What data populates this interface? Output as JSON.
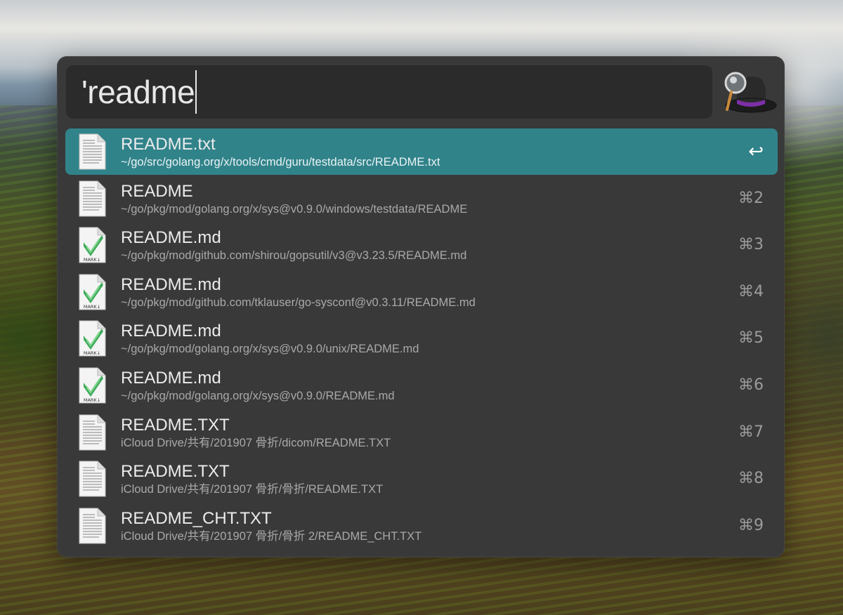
{
  "search": {
    "query": "'readme"
  },
  "results": [
    {
      "title": "README.txt",
      "path": "~/go/src/golang.org/x/tools/cmd/guru/testdata/src/README.txt",
      "shortcut": "↩",
      "icon": "text-file-icon",
      "selected": true
    },
    {
      "title": "README",
      "path": "~/go/pkg/mod/golang.org/x/sys@v0.9.0/windows/testdata/README",
      "shortcut": "⌘2",
      "icon": "text-file-icon"
    },
    {
      "title": "README.md",
      "path": "~/go/pkg/mod/github.com/shirou/gopsutil/v3@v3.23.5/README.md",
      "shortcut": "⌘3",
      "icon": "markdown-file-icon",
      "icon_label": "MARK↓"
    },
    {
      "title": "README.md",
      "path": "~/go/pkg/mod/github.com/tklauser/go-sysconf@v0.3.11/README.md",
      "shortcut": "⌘4",
      "icon": "markdown-file-icon",
      "icon_label": "MARK↓"
    },
    {
      "title": "README.md",
      "path": "~/go/pkg/mod/golang.org/x/sys@v0.9.0/unix/README.md",
      "shortcut": "⌘5",
      "icon": "markdown-file-icon",
      "icon_label": "MARK↓"
    },
    {
      "title": "README.md",
      "path": "~/go/pkg/mod/golang.org/x/sys@v0.9.0/README.md",
      "shortcut": "⌘6",
      "icon": "markdown-file-icon",
      "icon_label": "MARK↓"
    },
    {
      "title": "README.TXT",
      "path": "iCloud Drive/共有/201907 骨折/dicom/README.TXT",
      "shortcut": "⌘7",
      "icon": "text-file-icon"
    },
    {
      "title": "README.TXT",
      "path": "iCloud Drive/共有/201907 骨折/骨折/README.TXT",
      "shortcut": "⌘8",
      "icon": "text-file-icon"
    },
    {
      "title": "README_CHT.TXT",
      "path": "iCloud Drive/共有/201907 骨折/骨折 2/README_CHT.TXT",
      "shortcut": "⌘9",
      "icon": "text-file-icon"
    }
  ],
  "colors": {
    "selected_row": "#31838a",
    "panel": "#393939",
    "search_field": "#2b2b2b"
  },
  "logo": {
    "icon": "alfred-hat-icon"
  }
}
